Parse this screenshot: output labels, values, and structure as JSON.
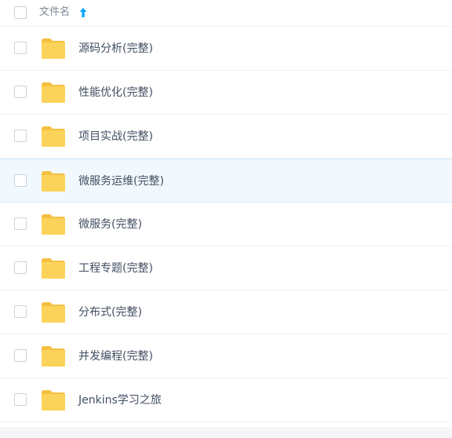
{
  "header": {
    "column_label": "文件名",
    "sort_direction": "ascending",
    "sort_icon": "arrow-up-icon"
  },
  "colors": {
    "folder": "#fcd35a",
    "accent": "#06a7ff",
    "hover_row_bg": "#f1f8fe"
  },
  "files": [
    {
      "name": "源码分析(完整)",
      "icon": "folder-icon"
    },
    {
      "name": "性能优化(完整)",
      "icon": "folder-icon"
    },
    {
      "name": "项目实战(完整)",
      "icon": "folder-icon"
    },
    {
      "name": "微服务运维(完整)",
      "icon": "folder-icon",
      "hovered": true
    },
    {
      "name": "微服务(完整)",
      "icon": "folder-icon"
    },
    {
      "name": "工程专题(完整)",
      "icon": "folder-icon"
    },
    {
      "name": "分布式(完整)",
      "icon": "folder-icon"
    },
    {
      "name": "并发编程(完整)",
      "icon": "folder-icon"
    },
    {
      "name": "Jenkins学习之旅",
      "icon": "folder-icon"
    }
  ]
}
